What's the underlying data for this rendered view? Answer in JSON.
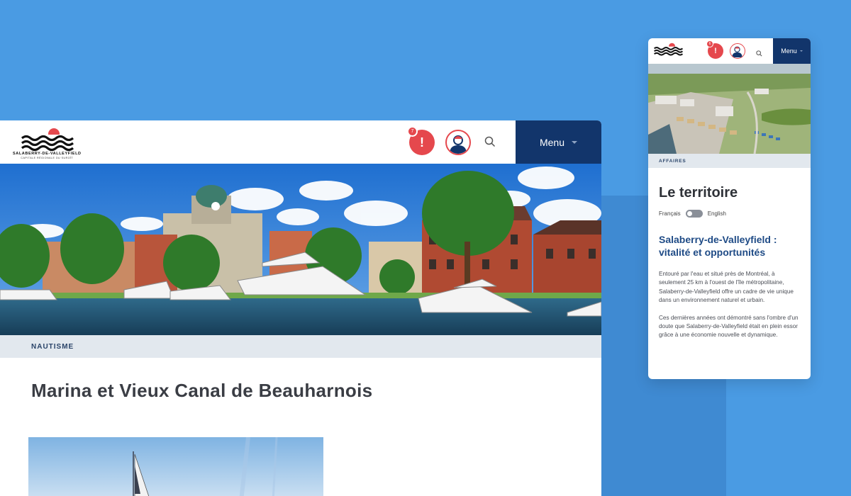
{
  "logo": {
    "line1": "SALABERRY-DE-VALLEYFIELD",
    "line2": "CAPITALE RÉGIONALE DU SUROÎT"
  },
  "desktop": {
    "alert_symbol": "!",
    "alert_count": "7",
    "menu_label": "Menu",
    "category": "NAUTISME",
    "title": "Marina et Vieux Canal de Beauharnois"
  },
  "mobile": {
    "alert_symbol": "!",
    "alert_count": "6",
    "menu_label": "Menu",
    "category": "AFFAIRES",
    "title": "Le territoire",
    "lang_fr": "Français",
    "lang_en": "English",
    "subtitle": "Salaberry-de-Valleyfield : vitalité et opportunités",
    "para1": "Entouré par l'eau et situé près de Montréal, à seulement 25 km à l'ouest de l'île métropolitaine, Salaberry-de-Valleyfield offre un cadre de vie unique dans un environnement naturel et urbain.",
    "para2": "Ces dernières années ont démontré sans l'ombre d'un doute que Salaberry-de-Valleyfield était en plein essor grâce à une économie nouvelle et dynamique."
  },
  "colors": {
    "background": "#4a9be3",
    "navy": "#12356b",
    "red": "#e5484d"
  },
  "icons": [
    "logo-waves-icon",
    "alert-icon",
    "user-icon",
    "search-icon",
    "chevron-down-icon"
  ]
}
